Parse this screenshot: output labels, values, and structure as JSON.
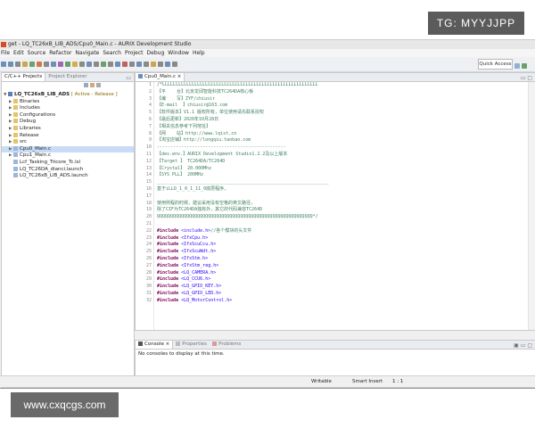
{
  "watermarks": {
    "top": "TG: MYYJJPP",
    "bottom": "www.cxqcgs.com"
  },
  "window": {
    "title": "get - LQ_TC26xB_LIB_ADS/Cpu0_Main.c - AURIX Development Studio"
  },
  "menu": [
    "File",
    "Edit",
    "Source",
    "Refactor",
    "Navigate",
    "Search",
    "Project",
    "Debug",
    "Window",
    "Help"
  ],
  "toolbar": {
    "quick_access": "Quick Access"
  },
  "left_panel": {
    "tabs": [
      "C/C++ Projects",
      "Project Explorer"
    ],
    "tree": [
      {
        "label": "LQ_TC26xB_LIB_ADS",
        "suffix": " [ Active - Release ]",
        "level": 0,
        "expanded": true,
        "selected": false
      },
      {
        "label": "Binaries",
        "level": 1,
        "expanded": false
      },
      {
        "label": "Includes",
        "level": 1,
        "expanded": false
      },
      {
        "label": "Configurations",
        "level": 1,
        "expanded": false
      },
      {
        "label": "Debug",
        "level": 1,
        "expanded": false
      },
      {
        "label": "Libraries",
        "level": 1,
        "expanded": false
      },
      {
        "label": "Release",
        "level": 1,
        "expanded": false
      },
      {
        "label": "src",
        "level": 1,
        "expanded": false
      },
      {
        "label": "Cpu0_Main.c",
        "level": 1,
        "expanded": false,
        "selected": true
      },
      {
        "label": "Cpu1_Main.c",
        "level": 1,
        "expanded": false
      },
      {
        "label": "Lcf_Tasking_Tricore_Tc.lsl",
        "level": 1,
        "leaf": true
      },
      {
        "label": "LQ_TC26DA_dianci.launch",
        "level": 1,
        "leaf": true
      },
      {
        "label": "LQ_TC26xB_LIB_ADS.launch",
        "level": 1,
        "leaf": true
      }
    ]
  },
  "editor": {
    "tab": "Cpu0_Main.c",
    "lines": [
      {
        "n": "1",
        "t": "/*LLLLLLLLLLLLLLLLLLLLLLLLLLLLLLLLLLLLLLLLLLLLLLLLLLLLLLLLLL",
        "c": "cm"
      },
      {
        "n": "2",
        "t": "【平    台】北京龙邱智能科技TC264DA核心板",
        "c": "cm"
      },
      {
        "n": "3",
        "t": "【编    写】ZYF/chiusir",
        "c": "cm"
      },
      {
        "n": "4",
        "t": "【E-mail  】chiusir@163.com",
        "c": "cm"
      },
      {
        "n": "5",
        "t": "【软件版本】V1.1 版权所有，单位使用请先联系授权",
        "c": "cm"
      },
      {
        "n": "6",
        "t": "【最后更新】2020年10月28日",
        "c": "cm"
      },
      {
        "n": "7",
        "t": "【相关信息参考下列地址】",
        "c": "cm"
      },
      {
        "n": "8",
        "t": "【网    站】http://www.lqist.cn",
        "c": "cm"
      },
      {
        "n": "9",
        "t": "【淘宝店铺】http://longqiu.taobao.com",
        "c": "cm"
      },
      {
        "n": "10",
        "t": "------------------------------------------------",
        "c": "cm"
      },
      {
        "n": "11",
        "t": "【dev.env.】AURIX Development Studio1.2.2及以上版本",
        "c": "cm"
      },
      {
        "n": "12",
        "t": "【Target 】 TC264DA/TC264D",
        "c": "cm"
      },
      {
        "n": "13",
        "t": "【Crystal】 20.000Mhz",
        "c": "cm"
      },
      {
        "n": "14",
        "t": "【SYS PLL】 200MHz",
        "c": "cm"
      },
      {
        "n": "15",
        "t": "________________________________________________________________",
        "c": "cm"
      },
      {
        "n": "16",
        "t": "基于iLLD_1_0_1_11_0底层程序,",
        "c": "cm"
      },
      {
        "n": "17",
        "t": "",
        "c": "cm"
      },
      {
        "n": "18",
        "t": "使用例程的时候，建议采用没有空格的英文路径，",
        "c": "cm"
      },
      {
        "n": "19",
        "t": "除了CIF为TC264DA独有外，其它的代码兼容TC264D",
        "c": "cm"
      },
      {
        "n": "20",
        "t": "QQQQQQQQQQQQQQQQQQQQQQQQQQQQQQQQQQQQQQQQQQQQQQQQQQQQQQQQQQ*/",
        "c": "cm"
      },
      {
        "n": "21",
        "t": "",
        "c": "cm"
      },
      {
        "n": "22",
        "kw": "#include",
        "t": " <include.h>",
        "tail": "//各个模块的头文件",
        "c": "inc"
      },
      {
        "n": "23",
        "kw": "#include",
        "t": " <IfxCpu.h>",
        "c": "inc"
      },
      {
        "n": "24",
        "kw": "#include",
        "t": " <IfxScuCcu.h>",
        "c": "inc"
      },
      {
        "n": "25",
        "kw": "#include",
        "t": " <IfxScuWdt.h>",
        "c": "inc"
      },
      {
        "n": "26",
        "kw": "#include",
        "t": " <IfxStm.h>",
        "c": "inc"
      },
      {
        "n": "27",
        "kw": "#include",
        "t": " <IfxStm_reg.h>",
        "c": "inc"
      },
      {
        "n": "28",
        "kw": "#include",
        "t": " <LQ_CAMERA.h>",
        "c": "inc"
      },
      {
        "n": "29",
        "kw": "#include",
        "t": " <LQ_CCU6.h>",
        "c": "inc"
      },
      {
        "n": "30",
        "kw": "#include",
        "t": " <LQ_GPIO_KEY.h>",
        "c": "inc"
      },
      {
        "n": "31",
        "kw": "#include",
        "t": " <LQ_GPIO_LED.h>",
        "c": "inc"
      },
      {
        "n": "32",
        "kw": "#include",
        "t": " <LQ_MotorControl.h>",
        "c": "inc"
      }
    ]
  },
  "console": {
    "tabs": [
      "Console",
      "Properties",
      "Problems"
    ],
    "message": "No consoles to display at this time."
  },
  "statusbar": {
    "mode": "Writable",
    "insert": "Smart Insert",
    "position": "1 : 1"
  },
  "colors": {
    "accent": "#c8dcf5",
    "comment": "#3f7f5f",
    "keyword": "#7f0055",
    "string": "#2a00ff"
  }
}
